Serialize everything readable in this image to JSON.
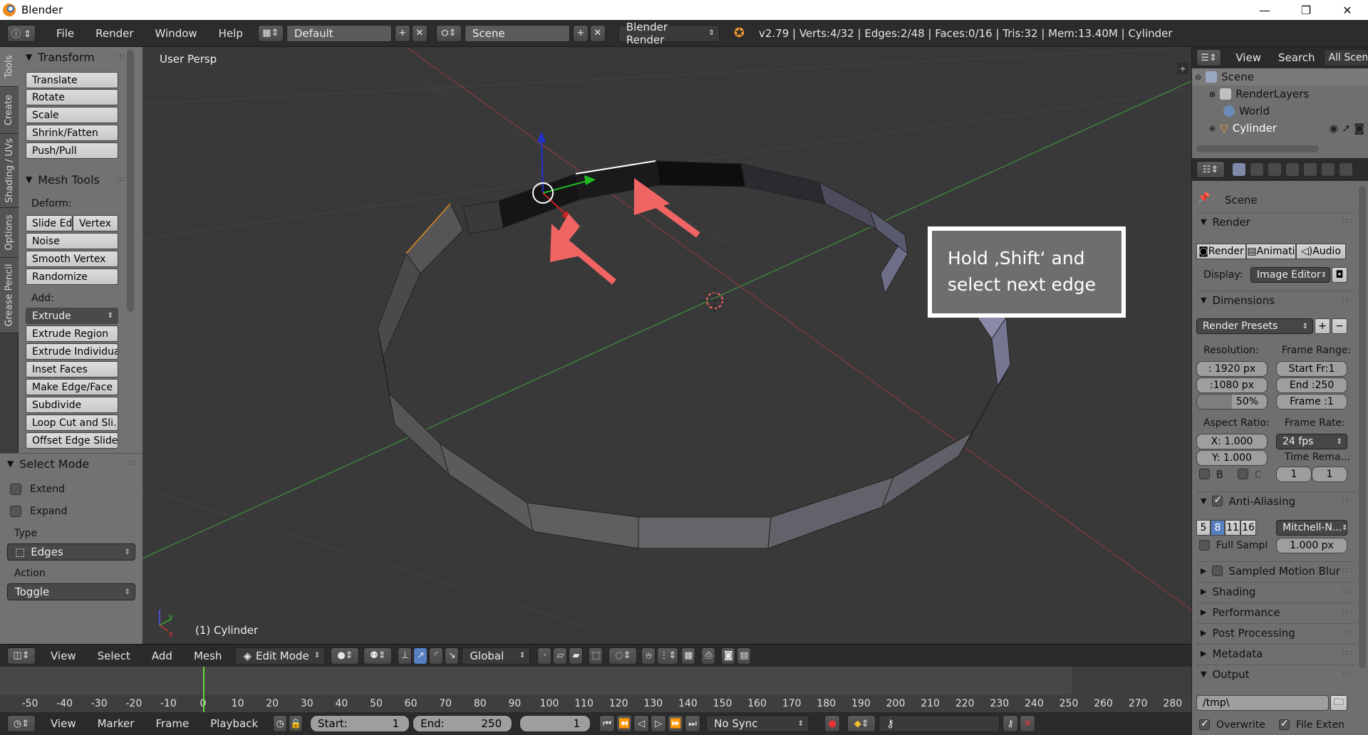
{
  "window": {
    "title": "Blender",
    "controls": [
      "—",
      "❐",
      "✕"
    ]
  },
  "info_header": {
    "menus": [
      "File",
      "Render",
      "Window",
      "Help"
    ],
    "layout": "Default",
    "scene": "Scene",
    "engine": "Blender Render",
    "stats": "v2.79 | Verts:4/32 | Edges:2/48 | Faces:0/16 | Tris:32 | Mem:13.40M | Cylinder"
  },
  "tool_tabs": [
    "Tools",
    "Create",
    "Shading / UVs",
    "Options",
    "Grease Pencil"
  ],
  "tool_shelf": {
    "transform": {
      "title": "Transform",
      "buttons": [
        "Translate",
        "Rotate",
        "Scale",
        "Shrink/Fatten",
        "Push/Pull"
      ]
    },
    "mesh_tools": {
      "title": "Mesh Tools",
      "deform_label": "Deform:",
      "slide_edge": "Slide Ed",
      "vertex": "Vertex",
      "deform_buttons": [
        "Noise",
        "Smooth Vertex",
        "Randomize"
      ],
      "add_label": "Add:",
      "extrude": "Extrude",
      "add_buttons": [
        "Extrude Region",
        "Extrude Individual",
        "Inset Faces",
        "Make Edge/Face",
        "Subdivide",
        "Loop Cut and Sli...",
        "Offset Edge Slide"
      ]
    }
  },
  "operator_panel": {
    "title": "Select Mode",
    "extend": "Extend",
    "expand": "Expand",
    "type_label": "Type",
    "type_value": "Edges",
    "action_label": "Action",
    "action_value": "Toggle"
  },
  "viewport": {
    "view_name": "User Persp",
    "object_label": "(1) Cylinder",
    "callout_line1": "Hold ‚Shift‘ and",
    "callout_line2": "select next edge"
  },
  "view3d_header": {
    "menus": [
      "View",
      "Select",
      "Add",
      "Mesh"
    ],
    "mode": "Edit Mode",
    "orientation": "Global"
  },
  "timeline": {
    "ticks": [
      "-50",
      "-40",
      "-30",
      "-20",
      "-10",
      "0",
      "10",
      "20",
      "30",
      "40",
      "50",
      "60",
      "70",
      "80",
      "90",
      "100",
      "110",
      "120",
      "130",
      "140",
      "150",
      "160",
      "170",
      "180",
      "190",
      "200",
      "210",
      "220",
      "230",
      "240",
      "250",
      "260",
      "270",
      "280"
    ],
    "current_frame": 0,
    "header_menus": [
      "View",
      "Marker",
      "Frame",
      "Playback"
    ],
    "start_label": "Start:",
    "start_value": "1",
    "end_label": "End:",
    "end_value": "250",
    "frame_value": "1",
    "sync": "No Sync"
  },
  "outliner": {
    "menus": [
      "View",
      "Search"
    ],
    "filter": "All Scenes",
    "items": [
      "Scene",
      "RenderLayers",
      "World",
      "Cylinder"
    ]
  },
  "properties": {
    "context": "Scene",
    "render": {
      "title": "Render",
      "buttons": [
        "Render",
        "Animati",
        "Audio"
      ],
      "display_label": "Display:",
      "display_value": "Image Editor"
    },
    "dimensions": {
      "title": "Dimensions",
      "presets": "Render Presets",
      "resolution_label": "Resolution:",
      "res_x": ": 1920 px",
      "res_y": ":1080 px",
      "res_pct": "50%",
      "frame_range_label": "Frame Range:",
      "start": "Start Fr:1",
      "end": "End :250",
      "frame": "Frame :1",
      "aspect_label": "Aspect Ratio:",
      "aspect_x": "X:  1.000",
      "aspect_y": "Y:  1.000",
      "frame_rate_label": "Frame Rate:",
      "fps": "24 fps",
      "time_remap_label": "Time Rema...",
      "border": "B",
      "crop": "C",
      "remap_old": "1",
      "remap_new": "1"
    },
    "anti_aliasing": {
      "title": "Anti-Aliasing",
      "samples": [
        "5",
        "8",
        "11",
        "16"
      ],
      "selected": "8",
      "filter": "Mitchell-N...",
      "full_sample": "Full Sampl",
      "size": "1.000 px"
    },
    "sections": [
      "Sampled Motion Blur",
      "Shading",
      "Performance",
      "Post Processing",
      "Metadata",
      "Output"
    ],
    "output_path": "/tmp\\",
    "overwrite": "Overwrite",
    "file_extensions": "File Exten"
  }
}
